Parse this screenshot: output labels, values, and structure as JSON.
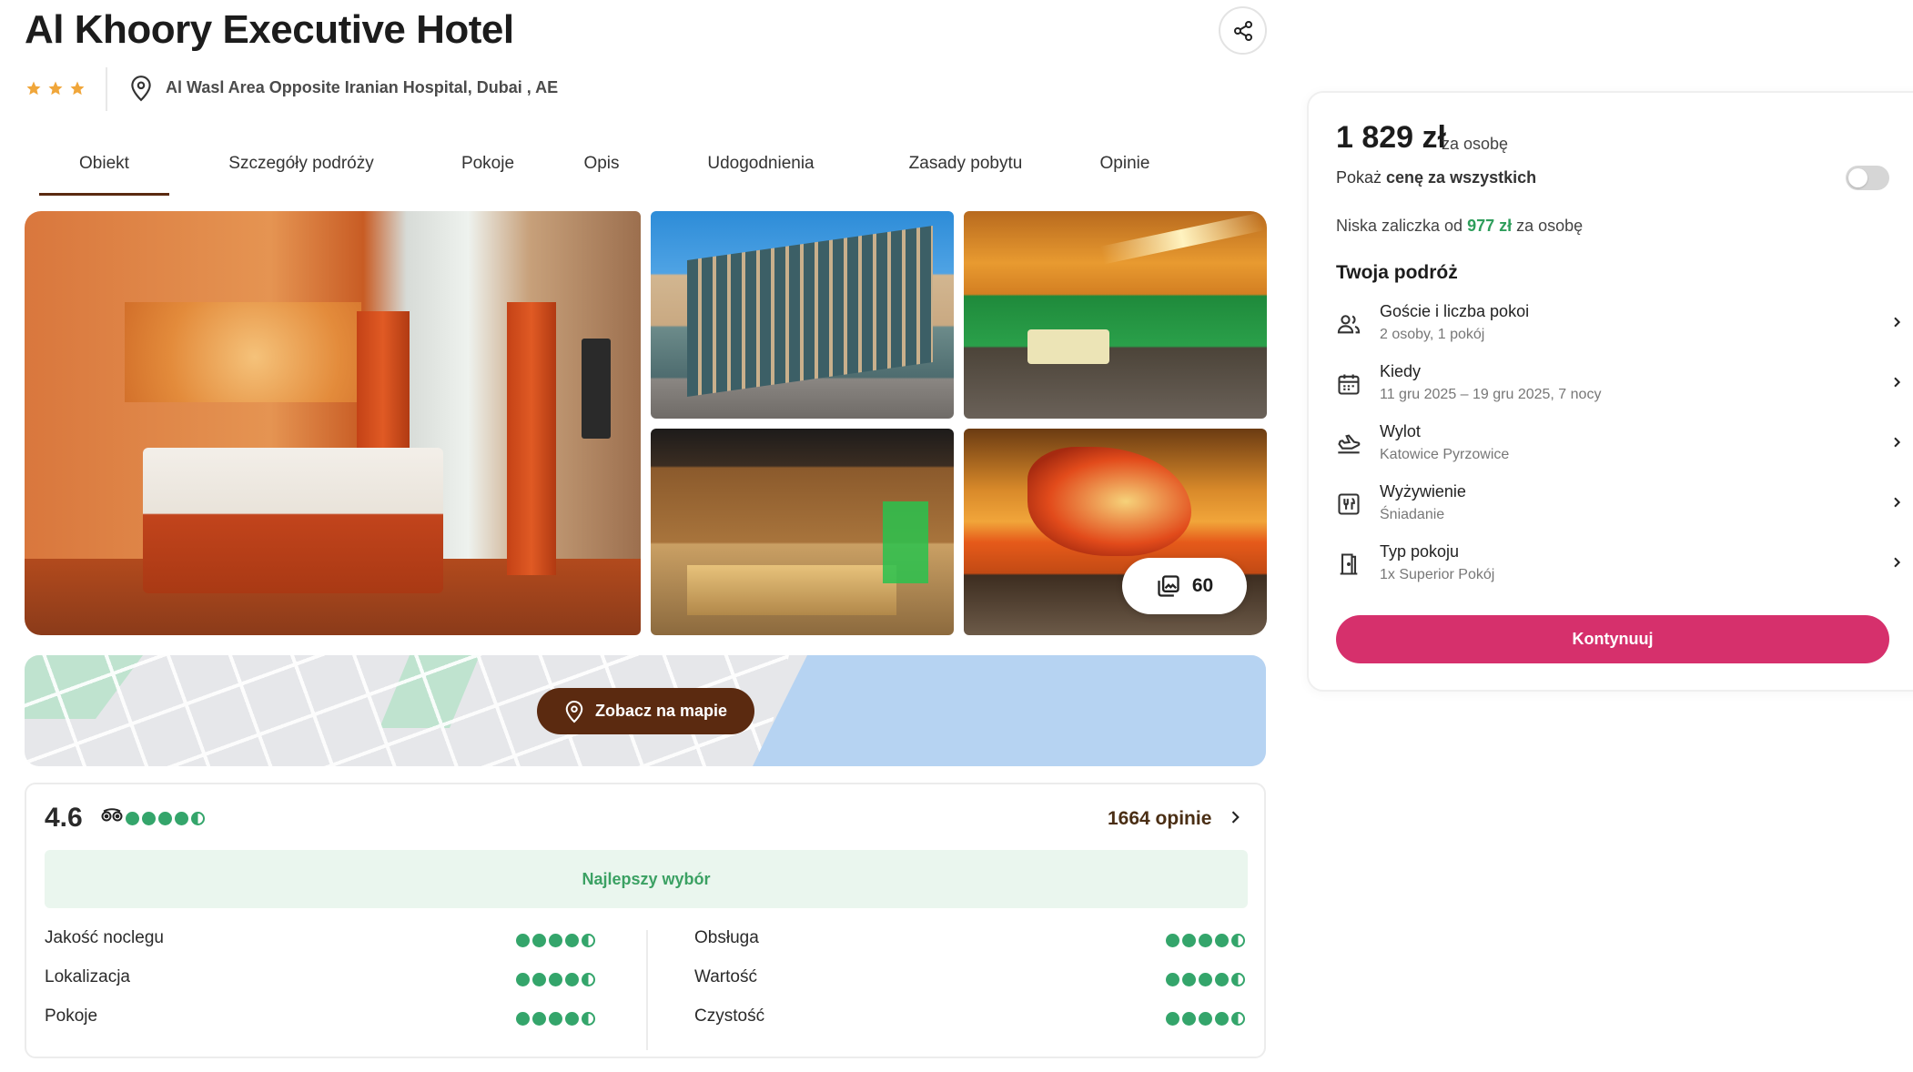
{
  "hotel": {
    "name": "Al Khoory Executive Hotel",
    "stars": 3,
    "address": "Al Wasl Area Opposite Iranian Hospital, Dubai , AE"
  },
  "tabs": [
    {
      "label": "Obiekt",
      "active": true
    },
    {
      "label": "Szczegóły podróży",
      "active": false
    },
    {
      "label": "Pokoje",
      "active": false
    },
    {
      "label": "Opis",
      "active": false
    },
    {
      "label": "Udogodnienia",
      "active": false
    },
    {
      "label": "Zasady pobytu",
      "active": false
    },
    {
      "label": "Opinie",
      "active": false
    }
  ],
  "gallery": {
    "photo_count": "60"
  },
  "map": {
    "button_label": "Zobacz na mapie"
  },
  "reviews": {
    "rating": "4.6",
    "rating_value": 4.5,
    "count_label": "1664 opinie",
    "badge": "Najlepszy wybór",
    "criteria_left": [
      {
        "label": "Jakość noclegu",
        "value": 4.5
      },
      {
        "label": "Lokalizacja",
        "value": 4.5
      },
      {
        "label": "Pokoje",
        "value": 4.5
      }
    ],
    "criteria_right": [
      {
        "label": "Obsługa",
        "value": 4.5
      },
      {
        "label": "Wartość",
        "value": 4.5
      },
      {
        "label": "Czystość",
        "value": 4.5
      }
    ]
  },
  "booking": {
    "price": "1 829 zł",
    "price_suffix": "za osobę",
    "show_total_prefix": "Pokaż ",
    "show_total_bold": "cenę za wszystkich",
    "toggle_on": false,
    "deposit_prefix": "Niska zaliczka od ",
    "deposit_amount": "977 zł",
    "deposit_suffix": " za osobę",
    "trip_heading": "Twoja podróż",
    "trip": [
      {
        "label": "Goście i liczba pokoi",
        "value": "2 osoby, 1 pokój",
        "icon": "guests-icon"
      },
      {
        "label": "Kiedy",
        "value": "11 gru 2025 – 19 gru 2025, 7 nocy",
        "icon": "calendar-icon"
      },
      {
        "label": "Wylot",
        "value": "Katowice Pyrzowice",
        "icon": "plane-departure-icon"
      },
      {
        "label": "Wyżywienie",
        "value": "Śniadanie",
        "icon": "meal-icon"
      },
      {
        "label": "Typ pokoju",
        "value": "1x Superior Pokój",
        "icon": "door-icon"
      }
    ],
    "continue_label": "Kontynuuj"
  },
  "colors": {
    "primary_brown": "#5b2a10",
    "cta_pink": "#d6306c",
    "rating_green": "#34a56b",
    "star_gold": "#f0a63a"
  }
}
